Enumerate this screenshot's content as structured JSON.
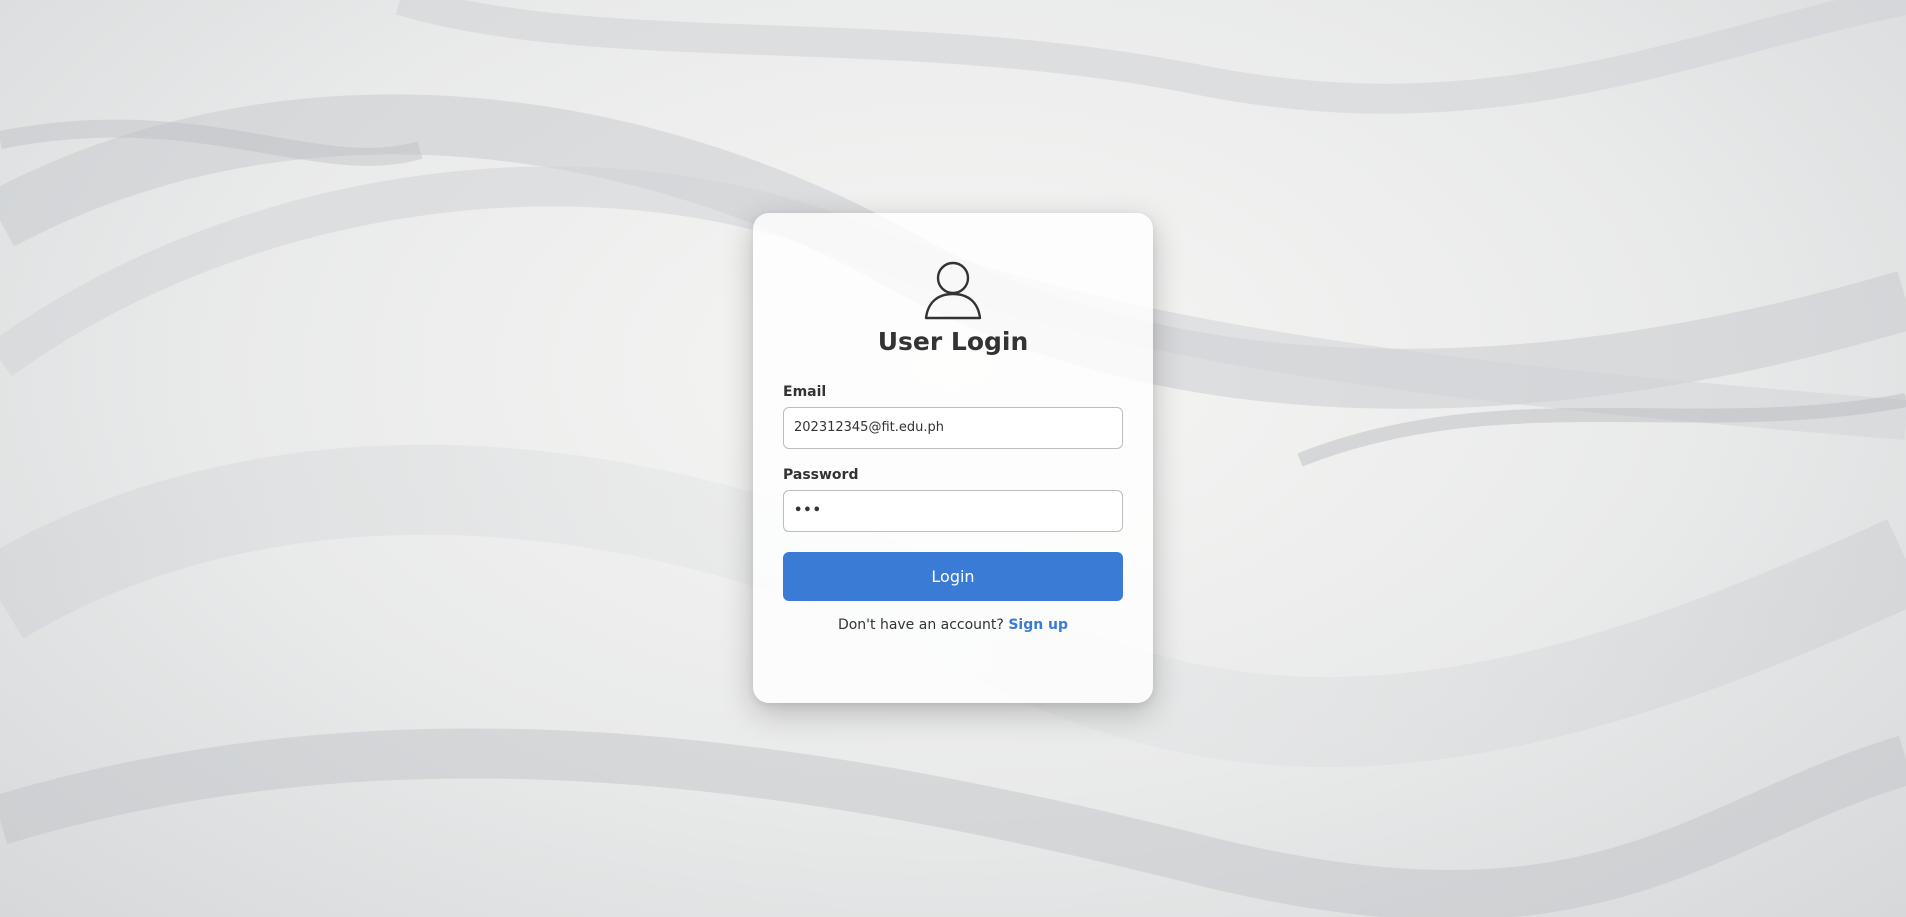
{
  "login": {
    "title": "User Login",
    "email_label": "Email",
    "email_value": "202312345@fit.edu.ph",
    "password_label": "Password",
    "password_value": "•••",
    "login_button": "Login",
    "signup_prompt": "Don't have an account?",
    "signup_link": "Sign up"
  },
  "icons": {
    "avatar": "user-icon"
  },
  "colors": {
    "accent": "#3a7bd5",
    "text": "#333333",
    "input_border": "#bdbdbd",
    "card": "#ffffff"
  }
}
